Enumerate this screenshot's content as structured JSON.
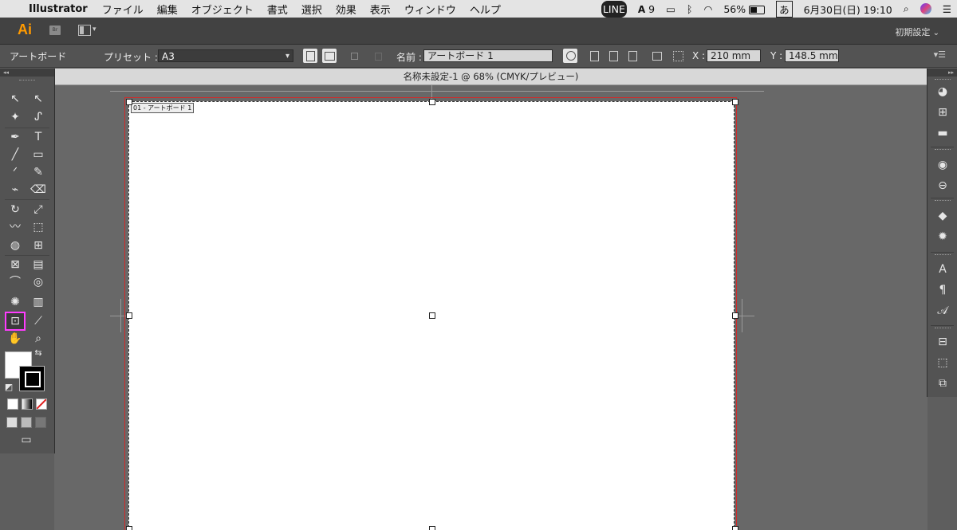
{
  "menubar": {
    "app_name": "Illustrator",
    "items": [
      "ファイル",
      "編集",
      "オブジェクト",
      "書式",
      "選択",
      "効果",
      "表示",
      "ウィンドウ",
      "ヘルプ"
    ],
    "status": {
      "line_badge": "LINE",
      "adobe_count": "9",
      "battery": "56%",
      "ime": "あ",
      "datetime": "6月30日(日) 19:10"
    }
  },
  "appbar": {
    "logo": "Ai",
    "bridge": "Br",
    "workspace": "初期設定"
  },
  "control_bar": {
    "tool_name": "アートボード",
    "preset_label": "プリセット :",
    "preset_value": "A3",
    "name_label": "名前 :",
    "name_value": "アートボード 1",
    "x_label": "X :",
    "x_value": "210 mm",
    "y_label": "Y :",
    "y_value": "148.5 mm"
  },
  "document": {
    "tab_title": "名称未設定-1 @ 68% (CMYK/プレビュー)",
    "artboard_label": "01 - アートボード 1"
  },
  "tools": {
    "collapse": "◂◂",
    "icons": {
      "selection": "↖",
      "direct_selection": "↖",
      "magic_wand": "✦",
      "lasso": "ᔑ",
      "pen": "✒",
      "type": "T",
      "line": "╱",
      "rect": "▭",
      "brush": "ᐟ",
      "pencil": "✎",
      "blob": "⌁",
      "eraser": "⌫",
      "rotate": "↻",
      "scale": "⤢",
      "warp": "〰",
      "free_transform": "⬚",
      "shape_builder": "◍",
      "perspective": "⊞",
      "mesh": "⊠",
      "gradient": "▤",
      "eyedropper": "⌒",
      "blend": "◎",
      "symbol_sprayer": "✺",
      "graph": "▥",
      "artboard": "⊡",
      "slice": "⟋",
      "hand": "✋",
      "zoom": "⌕",
      "swap": "⇆",
      "default_colors": "◩",
      "screen_mode": "▭"
    }
  },
  "right_dock": {
    "collapse": "▸▸",
    "icons": [
      "◕",
      "⊞",
      "▬",
      "◉",
      "⊖",
      "◆",
      "✹",
      "A",
      "¶",
      "𝒜",
      "⊟",
      "⬚",
      "⧉"
    ]
  }
}
